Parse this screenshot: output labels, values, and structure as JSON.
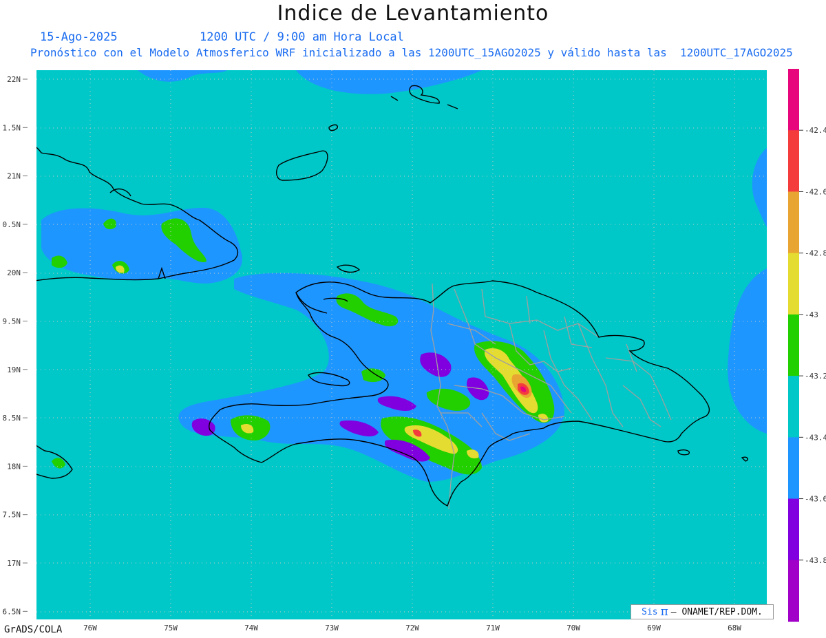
{
  "title": "Indice de Levantamiento",
  "header": {
    "date": "15-Ago-2025",
    "time": "1200 UTC / 9:00 am Hora Local",
    "description": "Pronóstico con el Modelo Atmosferico WRF inicializado a las 1200UTC_15AGO2025 y válido hasta las  1200UTC_17AGO2025"
  },
  "axes": {
    "lat_ticks": [
      "22N",
      "1.5N",
      "21N",
      "0.5N",
      "20N",
      "9.5N",
      "19N",
      "8.5N",
      "18N",
      "7.5N",
      "17N",
      "6.5N"
    ],
    "lon_ticks": [
      "76W",
      "75W",
      "74W",
      "73W",
      "72W",
      "71W",
      "70W",
      "69W",
      "68W"
    ]
  },
  "colorbar": {
    "labels": [
      "-42.4",
      "-42.6",
      "-42.8",
      "-43",
      "-43.2",
      "-43.4",
      "-43.6",
      "-43.8"
    ],
    "colors": [
      "#e8067c",
      "#f53c3c",
      "#e8a531",
      "#e5dc32",
      "#22d000",
      "#00c8c8",
      "#1e96ff",
      "#8000e0",
      "#a000c8"
    ]
  },
  "colors": {
    "background_field": "#00c8c8",
    "blue_band": "#1e96ff",
    "green": "#22d000",
    "yellow": "#e5dc32",
    "orange": "#e8a531",
    "red": "#f53c3c",
    "magenta": "#e8067c",
    "purple": "#8000e0",
    "coast": "#000000",
    "province_lines": "#a0a0a0"
  },
  "credit": {
    "sis": "Sis",
    "pi": "π",
    "org": "– ONAMET/REP.DOM."
  },
  "footer": "GrADS/COLA"
}
